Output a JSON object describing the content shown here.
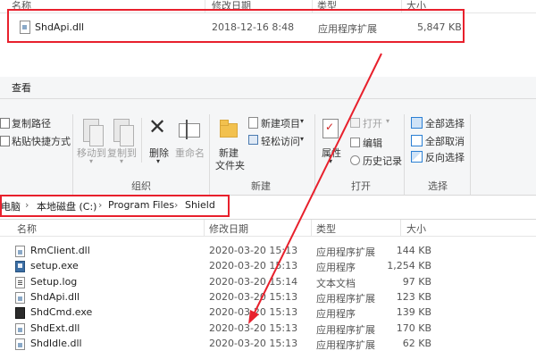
{
  "top_window": {
    "headers": {
      "name": "名称",
      "date": "修改日期",
      "type": "类型",
      "size": "大小"
    },
    "file": {
      "name": "ShdApi.dll",
      "date": "2018-12-16 8:48",
      "type": "应用程序扩展",
      "size": "5,847 KB"
    }
  },
  "ribbon": {
    "tab": "查看",
    "clipboard": {
      "copy_path": "复制路径",
      "paste_shortcut": "粘贴快捷方式"
    },
    "organize": {
      "label": "组织",
      "move_to": "移动到",
      "copy_to": "复制到",
      "delete": "删除",
      "rename": "重命名"
    },
    "new": {
      "label": "新建",
      "new_folder_line1": "新建",
      "new_folder_line2": "文件夹",
      "new_item": "新建项目",
      "easy_access": "轻松访问"
    },
    "open": {
      "label": "打开",
      "properties": "属性",
      "open": "打开",
      "edit": "编辑",
      "history": "历史记录"
    },
    "select": {
      "label": "选择",
      "select_all": "全部选择",
      "select_none": "全部取消",
      "invert": "反向选择"
    }
  },
  "address": {
    "computer": "电脑",
    "drive": "本地磁盘 (C:)",
    "folder1": "Program Files",
    "folder2": "Shield"
  },
  "list": {
    "headers": {
      "name": "名称",
      "date": "修改日期",
      "type": "类型",
      "size": "大小"
    },
    "rows": [
      {
        "name": "RmClient.dll",
        "date": "2020-03-20 15:13",
        "type": "应用程序扩展",
        "size": "144 KB",
        "icon": "dll"
      },
      {
        "name": "setup.exe",
        "date": "2020-03-20 15:13",
        "type": "应用程序",
        "size": "1,254 KB",
        "icon": "exe"
      },
      {
        "name": "Setup.log",
        "date": "2020-03-20 15:14",
        "type": "文本文档",
        "size": "97 KB",
        "icon": "log"
      },
      {
        "name": "ShdApi.dll",
        "date": "2020-03-20 15:13",
        "type": "应用程序扩展",
        "size": "123 KB",
        "icon": "dll"
      },
      {
        "name": "ShdCmd.exe",
        "date": "2020-03-20 15:13",
        "type": "应用程序",
        "size": "139 KB",
        "icon": "cmd"
      },
      {
        "name": "ShdExt.dll",
        "date": "2020-03-20 15:13",
        "type": "应用程序扩展",
        "size": "170 KB",
        "icon": "dll"
      },
      {
        "name": "ShdIdle.dll",
        "date": "2020-03-20 15:13",
        "type": "应用程序扩展",
        "size": "62 KB",
        "icon": "dll"
      }
    ]
  },
  "colors": {
    "highlight": "#e8202c",
    "accent": "#2a7fd4"
  }
}
